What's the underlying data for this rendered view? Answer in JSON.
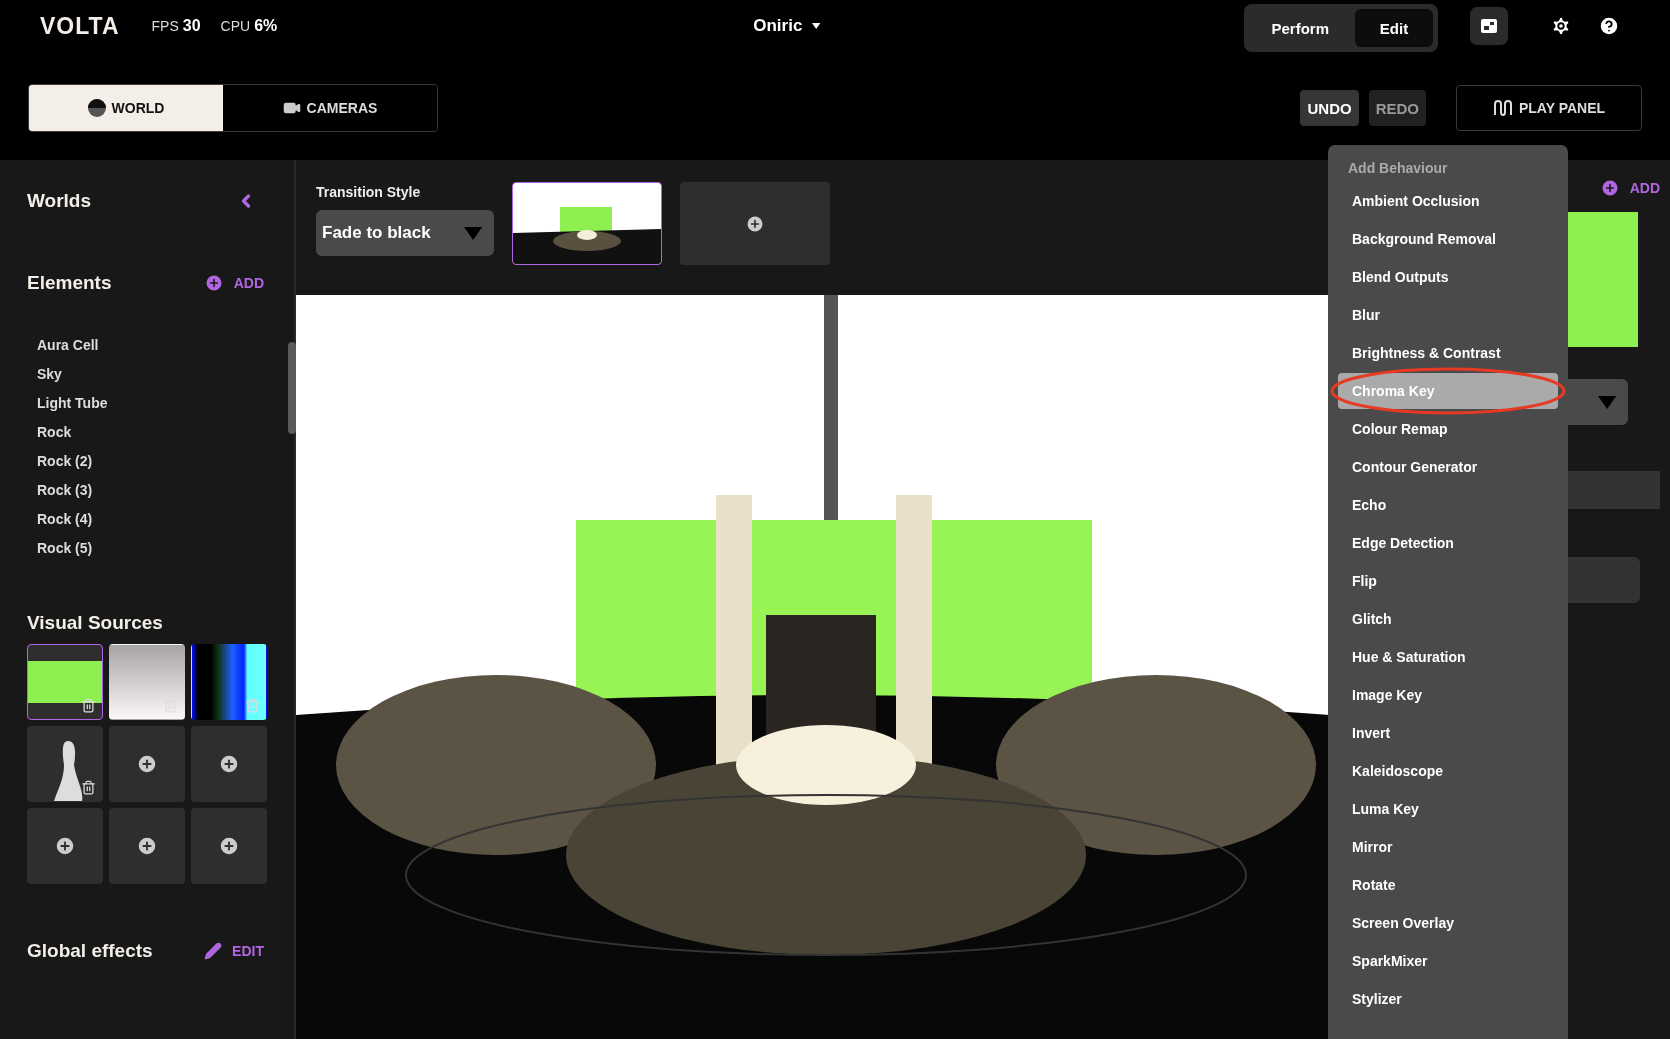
{
  "header": {
    "logo": "VOLTA",
    "stats": [
      {
        "label": "FPS",
        "value": "30"
      },
      {
        "label": "CPU",
        "value": "6%"
      }
    ],
    "project": "Oniric",
    "modes": [
      {
        "label": "Perform",
        "selected": false
      },
      {
        "label": "Edit",
        "selected": true
      }
    ]
  },
  "view_tabs": [
    {
      "label": "WORLD",
      "kind": "world",
      "selected": true
    },
    {
      "label": "CAMERAS",
      "kind": "cameras",
      "selected": false
    }
  ],
  "history": [
    {
      "label": "UNDO",
      "disabled": false
    },
    {
      "label": "REDO",
      "disabled": true
    }
  ],
  "play_panel": "PLAY PANEL",
  "sidebar": {
    "worlds_title": "Worlds",
    "elements": {
      "title": "Elements",
      "add_label": "ADD",
      "items": [
        "Aura Cell",
        "Sky",
        "Light Tube",
        "Rock",
        "Rock (2)",
        "Rock (3)",
        "Rock (4)",
        "Rock (5)"
      ]
    },
    "visual_sources": {
      "title": "Visual Sources",
      "tiles": [
        {
          "kind": "camera",
          "selected": true
        },
        {
          "kind": "gradient",
          "selected": false
        },
        {
          "kind": "spectrum",
          "selected": false
        },
        {
          "kind": "mask",
          "selected": false
        },
        {
          "kind": "empty",
          "selected": false
        },
        {
          "kind": "empty",
          "selected": false
        },
        {
          "kind": "empty",
          "selected": false
        },
        {
          "kind": "empty",
          "selected": false
        },
        {
          "kind": "empty",
          "selected": false
        }
      ]
    },
    "global_effects": {
      "title": "Global effects",
      "edit_label": "EDIT"
    }
  },
  "transition": {
    "label": "Transition Style",
    "value": "Fade to black"
  },
  "scenes": [
    {
      "kind": "scene",
      "selected": true
    },
    {
      "kind": "add",
      "selected": false
    }
  ],
  "right_panel": {
    "add_label": "ADD"
  },
  "menu": {
    "title": "Add Behaviour",
    "items": [
      {
        "label": "Ambient Occlusion",
        "selected": false
      },
      {
        "label": "Background Removal",
        "selected": false
      },
      {
        "label": "Blend Outputs",
        "selected": false
      },
      {
        "label": "Blur",
        "selected": false
      },
      {
        "label": "Brightness & Contrast",
        "selected": false
      },
      {
        "label": "Chroma Key",
        "selected": true
      },
      {
        "label": "Colour Remap",
        "selected": false
      },
      {
        "label": "Contour Generator",
        "selected": false
      },
      {
        "label": "Echo",
        "selected": false
      },
      {
        "label": "Edge Detection",
        "selected": false
      },
      {
        "label": "Flip",
        "selected": false
      },
      {
        "label": "Glitch",
        "selected": false
      },
      {
        "label": "Hue & Saturation",
        "selected": false
      },
      {
        "label": "Image Key",
        "selected": false
      },
      {
        "label": "Invert",
        "selected": false
      },
      {
        "label": "Kaleidoscope",
        "selected": false
      },
      {
        "label": "Luma Key",
        "selected": false
      },
      {
        "label": "Mirror",
        "selected": false
      },
      {
        "label": "Rotate",
        "selected": false
      },
      {
        "label": "Screen Overlay",
        "selected": false
      },
      {
        "label": "SparkMixer",
        "selected": false
      },
      {
        "label": "Stylizer",
        "selected": false
      }
    ]
  }
}
